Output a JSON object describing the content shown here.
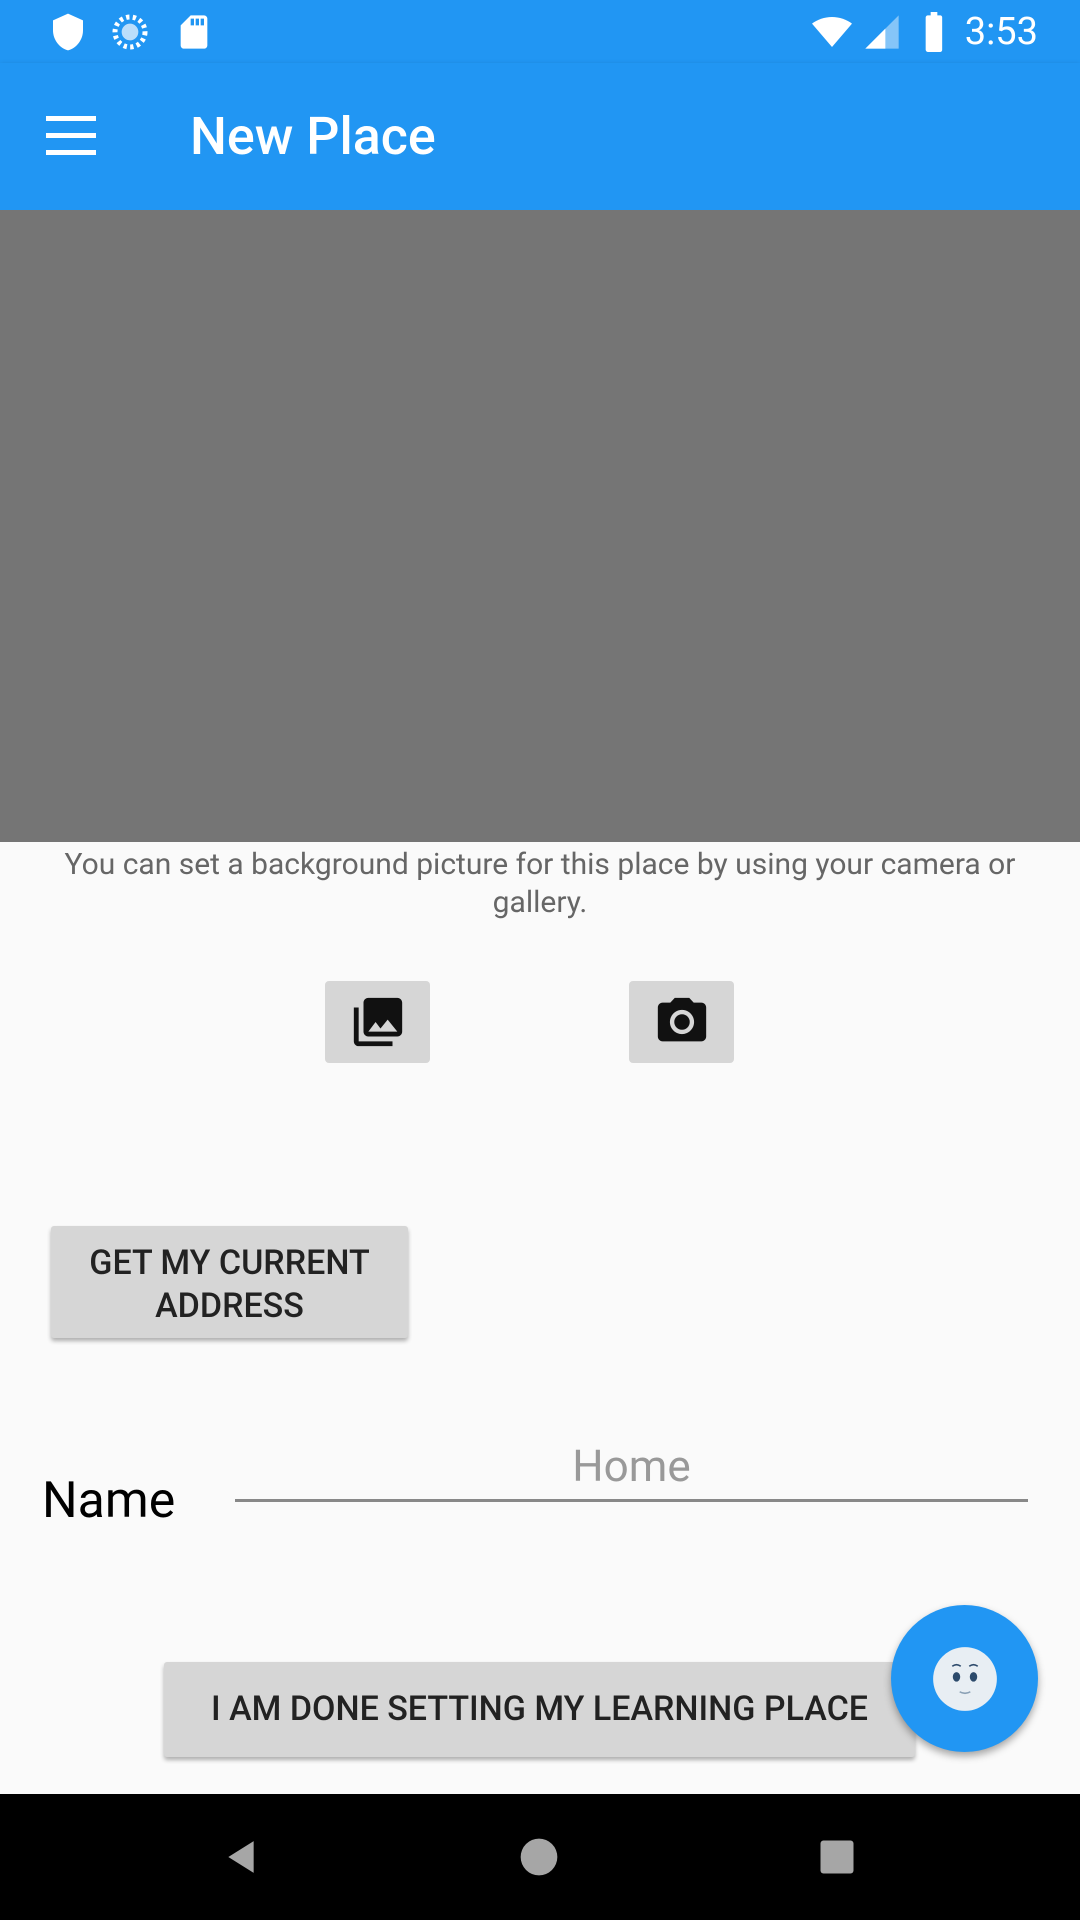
{
  "status_bar": {
    "time": "3:53",
    "left_icons": [
      "shield-icon",
      "sync-icon",
      "sd-card-icon"
    ],
    "right_icons": [
      "wifi-icon",
      "signal-icon",
      "battery-icon"
    ]
  },
  "app_bar": {
    "title": "New Place",
    "menu_icon": "hamburger-menu-icon",
    "color": "#2196f3"
  },
  "background_picture": {
    "color": "#757575",
    "hint": "You can set a background picture for this place by using your camera or gallery.",
    "gallery_icon": "photo-library-icon",
    "camera_icon": "camera-icon"
  },
  "address_button": {
    "label_line1": "GET MY CURRENT",
    "label_line2": "ADDRESS"
  },
  "name_field": {
    "label": "Name",
    "value": "",
    "placeholder": "Home"
  },
  "done_button": {
    "label": "I AM DONE SETTING MY LEARNING PLACE"
  },
  "fab": {
    "icon": "smiley-face-icon",
    "color": "#2196f3"
  },
  "nav_bar": {
    "buttons": [
      "back-icon",
      "home-icon",
      "recents-icon"
    ]
  }
}
